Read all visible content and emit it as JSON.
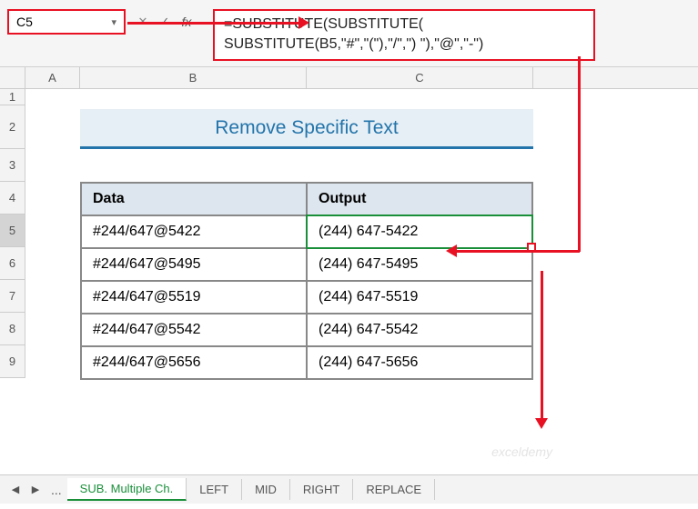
{
  "ribbon": {
    "cell_ref": "C5",
    "formula_line1": "=SUBSTITUTE(SUBSTITUTE(",
    "formula_line2": "SUBSTITUTE(B5,\"#\",\"(\"),\"/\",\") \"),\"@\",\"-\")"
  },
  "columns": [
    "A",
    "B",
    "C"
  ],
  "rows": [
    "1",
    "2",
    "3",
    "4",
    "5",
    "6",
    "7",
    "8",
    "9"
  ],
  "banner_title": "Remove Specific Text",
  "table": {
    "headers": [
      "Data",
      "Output"
    ],
    "rows": [
      {
        "data": "#244/647@5422",
        "output": "(244) 647-5422"
      },
      {
        "data": "#244/647@5495",
        "output": "(244) 647-5495"
      },
      {
        "data": "#244/647@5519",
        "output": "(244) 647-5519"
      },
      {
        "data": "#244/647@5542",
        "output": "(244) 647-5542"
      },
      {
        "data": "#244/647@5656",
        "output": "(244) 647-5656"
      }
    ]
  },
  "tabs": {
    "active": "SUB. Multiple Ch.",
    "others": [
      "LEFT",
      "MID",
      "RIGHT",
      "REPLACE"
    ]
  },
  "watermark": "exceldemy"
}
